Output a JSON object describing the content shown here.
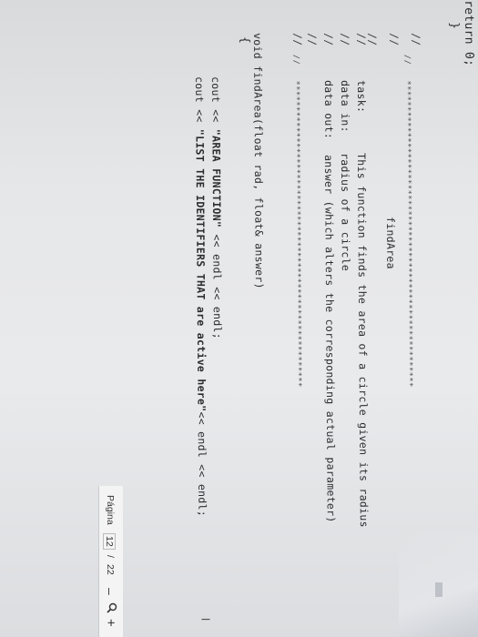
{
  "code": {
    "top_fragment": "return 0;",
    "top_brace": "}",
    "comment_prefix": "//",
    "stars_line": "//   ***********************************************************",
    "func_heading": "findArea",
    "task_label": "task:",
    "task_text": "This function finds the area of a circle given its radius",
    "data_in_label": "data in:",
    "data_in_text": "radius of a circle",
    "data_out_label": "data out:",
    "data_out_text": "answer (which alters the corresponding actual parameter)",
    "stars_line_bottom": "//   ***********************************************************",
    "signature": "void findArea(float rad, float& answer)",
    "open_brace": "{",
    "cout1_pre": "cout << ",
    "cout1_str": "\"AREA FUNCTION\"",
    "cout1_post": " << endl << endl;",
    "cout2_pre": "cout << ",
    "cout2_str": "\"LIST THE IDENTIFIERS THAT are active here\"",
    "cout2_post": "<< endl << endl;"
  },
  "toolbar": {
    "page_label": "Página",
    "current_page": "12",
    "separator": "/",
    "total_pages": "22",
    "zoom_out": "–",
    "zoom_icon": "magnifier-icon",
    "zoom_in": "+"
  },
  "cursor": "I"
}
